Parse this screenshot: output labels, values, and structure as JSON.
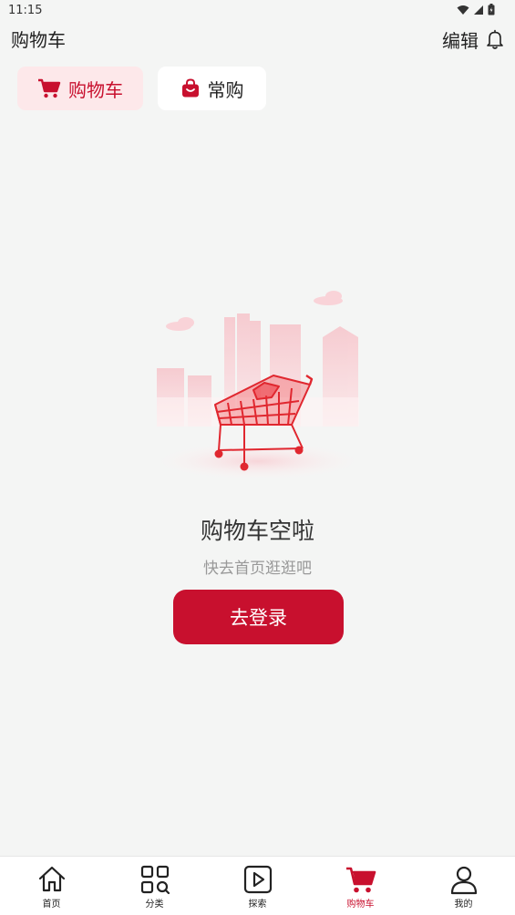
{
  "status": {
    "time": "11:15"
  },
  "header": {
    "title": "购物车",
    "edit_label": "编辑"
  },
  "tabs": [
    {
      "label": "购物车",
      "icon": "cart-icon",
      "active": true
    },
    {
      "label": "常购",
      "icon": "shopping-bag-icon",
      "active": false
    }
  ],
  "empty_state": {
    "illustration": "empty-cart-illustration",
    "title": "购物车空啦",
    "subtitle": "快去首页逛逛吧",
    "button_label": "去登录"
  },
  "nav": {
    "items": [
      {
        "label": "首页",
        "icon": "home-icon",
        "active": false
      },
      {
        "label": "分类",
        "icon": "category-grid-icon",
        "active": false
      },
      {
        "label": "探索",
        "icon": "play-icon",
        "active": false
      },
      {
        "label": "购物车",
        "icon": "cart-icon",
        "active": true
      },
      {
        "label": "我的",
        "icon": "user-icon",
        "active": false
      }
    ]
  },
  "colors": {
    "accent": "#c8102e",
    "background": "#f4f5f4",
    "tab_active_bg": "#fde8ea"
  }
}
